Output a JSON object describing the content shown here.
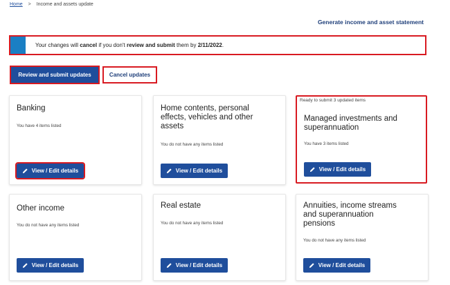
{
  "breadcrumb": {
    "home": "Home",
    "separator": ">",
    "current": "Income and assets update"
  },
  "header": {
    "generate_link": "Generate income and asset statement"
  },
  "alert": {
    "prefix": "Your changes will ",
    "bold1": "cancel",
    "middle": " if you don't ",
    "bold2": "review and submit",
    "suffix": " them by ",
    "date": "2/11/2022",
    "end": "."
  },
  "actions": {
    "review_label": "Review and submit updates",
    "cancel_label": "Cancel updates"
  },
  "cards": [
    {
      "title_lines": [
        "Banking"
      ],
      "subtitle": "You have 4 items listed",
      "button": "View / Edit details",
      "ready": ""
    },
    {
      "title_lines": [
        "Home contents, personal",
        "effects, vehicles and other",
        "assets"
      ],
      "subtitle": "You do not have any items listed",
      "button": "View / Edit details",
      "ready": ""
    },
    {
      "title_lines": [
        "Managed investments and",
        "superannuation"
      ],
      "subtitle": "You have 3 items listed",
      "button": "View / Edit details",
      "ready": "Ready to submit 3 updated items"
    },
    {
      "title_lines": [
        "Other income"
      ],
      "subtitle": "You do not have any items listed",
      "button": "View / Edit details",
      "ready": ""
    },
    {
      "title_lines": [
        "Real estate"
      ],
      "subtitle": "You do not have any items listed",
      "button": "View / Edit details",
      "ready": ""
    },
    {
      "title_lines": [
        "Annuities, income streams",
        "and superannuation",
        "pensions"
      ],
      "subtitle": "You do not have any items listed",
      "button": "View / Edit details",
      "ready": ""
    }
  ],
  "colors": {
    "primary": "#1f4e9c",
    "alert_bar": "#1a7fc4",
    "highlight": "#d81920"
  },
  "icons": {
    "edit": "pencil-icon"
  }
}
